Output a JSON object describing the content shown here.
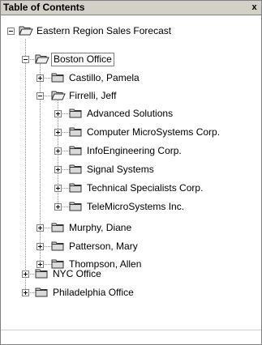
{
  "pane": {
    "title": "Table of Contents",
    "close_glyph": "x"
  },
  "tree": {
    "root": {
      "label": "Eastern Region Sales Forecast",
      "expanded": true
    },
    "offices": [
      {
        "label": "Boston Office",
        "expanded": true,
        "selected": true
      },
      {
        "label": "NYC Office",
        "expanded": false
      },
      {
        "label": "Philadelphia Office",
        "expanded": false
      }
    ],
    "boston_people": [
      {
        "label": "Castillo, Pamela",
        "expanded": false
      },
      {
        "label": "Firrelli, Jeff",
        "expanded": true
      },
      {
        "label": "Murphy, Diane",
        "expanded": false
      },
      {
        "label": "Patterson, Mary",
        "expanded": false
      },
      {
        "label": "Thompson, Allen",
        "expanded": false
      }
    ],
    "firrelli_customers": [
      {
        "label": "Advanced Solutions"
      },
      {
        "label": "Computer MicroSystems Corp."
      },
      {
        "label": "InfoEngineering Corp."
      },
      {
        "label": "Signal Systems"
      },
      {
        "label": "Technical Specialists Corp."
      },
      {
        "label": "TeleMicroSystems Inc."
      }
    ]
  },
  "icons": {
    "expand": "plus-box-icon",
    "collapse": "minus-box-icon",
    "open_folder": "open-folder-icon",
    "closed_folder": "closed-folder-icon"
  },
  "colors": {
    "title_bar": "#d4d0c8",
    "tree_lines": "#8c8c8c",
    "folder_fill": "#d9d9d9",
    "border": "#808080"
  }
}
